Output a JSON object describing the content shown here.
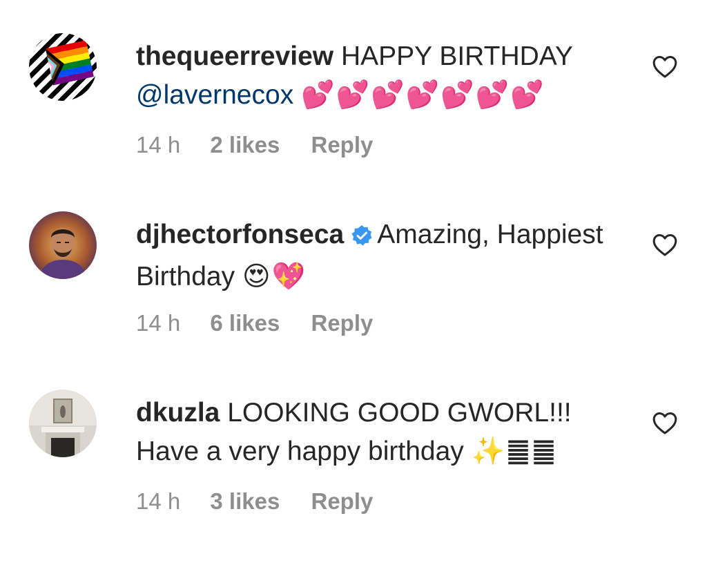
{
  "comments": [
    {
      "username": "thequeerreview",
      "verified": false,
      "text": "HAPPY BIRTHDAY",
      "mention": "@lavernecox",
      "emoji": "💕💕💕💕💕💕💕",
      "time": "14 h",
      "likes": "2 likes",
      "reply": "Reply"
    },
    {
      "username": "djhectorfonseca",
      "verified": true,
      "text": "Amazing, Happiest Birthday",
      "emoji": "😍💖",
      "time": "14 h",
      "likes": "6 likes",
      "reply": "Reply"
    },
    {
      "username": "dkuzla",
      "verified": false,
      "text": "LOOKING GOOD GWORL!!! Have a very happy birthday",
      "emoji": "✨䷀䷀",
      "time": "14 h",
      "likes": "3 likes",
      "reply": "Reply"
    }
  ],
  "icons": {
    "like": "heart-outline-icon",
    "verified": "verified-badge-icon"
  },
  "colors": {
    "text": "#262626",
    "meta": "#8e8e8e",
    "mention": "#00376b",
    "verified": "#3897f0"
  }
}
